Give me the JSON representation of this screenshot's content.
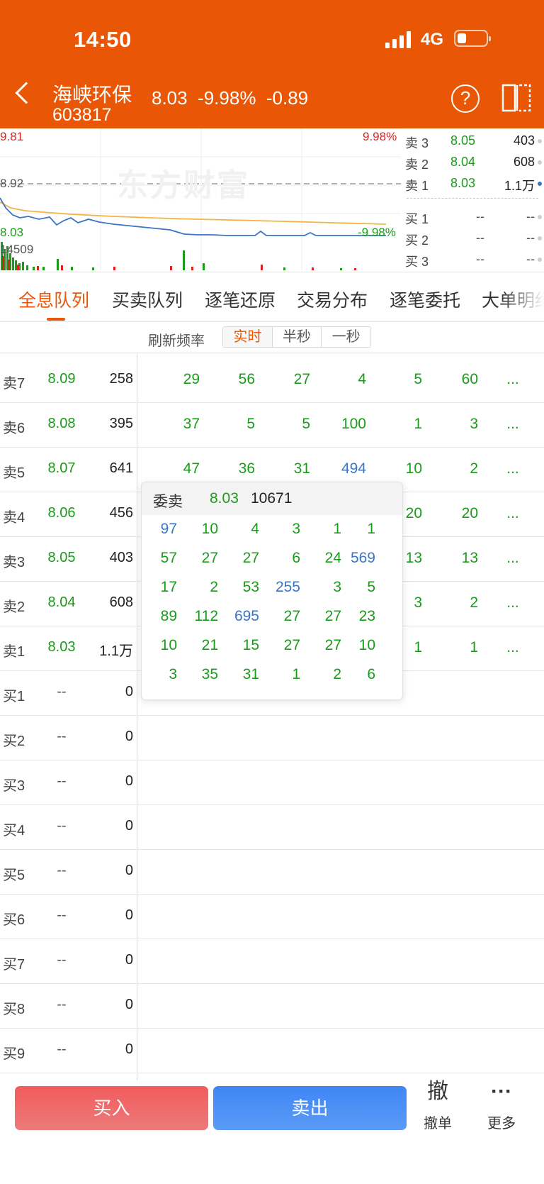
{
  "status": {
    "time": "14:50",
    "network": "4G"
  },
  "header": {
    "name": "海峡环保",
    "code": "603817",
    "quote": "8.03  -9.98%  -0.89",
    "help": "?"
  },
  "chart": {
    "watermark": "东方财富",
    "high": "9.81",
    "high_pct": "9.98%",
    "prev_close": "8.92",
    "low": "8.03",
    "low_pct": "-9.98%",
    "volume": "14509"
  },
  "book": [
    {
      "label": "卖 3",
      "price": "8.05",
      "vol": "403"
    },
    {
      "label": "卖 2",
      "price": "8.04",
      "vol": "608"
    },
    {
      "label": "卖 1",
      "price": "8.03",
      "vol": "1.1万"
    },
    {
      "label": "买 1",
      "price": "--",
      "vol": "--"
    },
    {
      "label": "买 2",
      "price": "--",
      "vol": "--"
    },
    {
      "label": "买 3",
      "price": "--",
      "vol": "--"
    }
  ],
  "tabs": [
    "全息队列",
    "买卖队列",
    "逐笔还原",
    "交易分布",
    "逐笔委托",
    "大单明细"
  ],
  "refresh": {
    "label": "刷新频率",
    "options": [
      "实时",
      "半秒",
      "一秒"
    ]
  },
  "rows": [
    {
      "label": "卖7",
      "price": "8.09",
      "vol": "258",
      "q": [
        "29",
        "56",
        "27",
        "4",
        "5",
        "60",
        "..."
      ]
    },
    {
      "label": "卖6",
      "price": "8.08",
      "vol": "395",
      "q": [
        "37",
        "5",
        "5",
        "100",
        "1",
        "3",
        "..."
      ]
    },
    {
      "label": "卖5",
      "price": "8.07",
      "vol": "641",
      "q": [
        "47",
        "36",
        "31",
        "494",
        "10",
        "2",
        "..."
      ]
    },
    {
      "label": "卖4",
      "price": "8.06",
      "vol": "456",
      "q": [
        "",
        "",
        "",
        "",
        "20",
        "20",
        "..."
      ]
    },
    {
      "label": "卖3",
      "price": "8.05",
      "vol": "403",
      "q": [
        "",
        "",
        "",
        "",
        "13",
        "13",
        "..."
      ]
    },
    {
      "label": "卖2",
      "price": "8.04",
      "vol": "608",
      "q": [
        "",
        "",
        "",
        "",
        "3",
        "2",
        "..."
      ]
    },
    {
      "label": "卖1",
      "price": "8.03",
      "vol": "1.1万",
      "q": [
        "",
        "",
        "",
        "",
        "1",
        "1",
        "..."
      ]
    },
    {
      "label": "买1",
      "price": "--",
      "vol": "0",
      "q": []
    },
    {
      "label": "买2",
      "price": "--",
      "vol": "0",
      "q": []
    },
    {
      "label": "买3",
      "price": "--",
      "vol": "0",
      "q": []
    },
    {
      "label": "买4",
      "price": "--",
      "vol": "0",
      "q": []
    },
    {
      "label": "买5",
      "price": "--",
      "vol": "0",
      "q": []
    },
    {
      "label": "买6",
      "price": "--",
      "vol": "0",
      "q": []
    },
    {
      "label": "买7",
      "price": "--",
      "vol": "0",
      "q": []
    },
    {
      "label": "买8",
      "price": "--",
      "vol": "0",
      "q": []
    },
    {
      "label": "买9",
      "price": "--",
      "vol": "0",
      "q": []
    }
  ],
  "popup": {
    "label": "委卖",
    "price": "8.03",
    "total": "10671",
    "rows": [
      [
        "97",
        "10",
        "4",
        "3",
        "1",
        "1"
      ],
      [
        "57",
        "27",
        "27",
        "6",
        "24",
        "569"
      ],
      [
        "17",
        "2",
        "53",
        "255",
        "3",
        "5"
      ],
      [
        "89",
        "112",
        "695",
        "27",
        "27",
        "23"
      ],
      [
        "10",
        "21",
        "15",
        "27",
        "27",
        "10"
      ],
      [
        "3",
        "35",
        "31",
        "1",
        "2",
        "6"
      ]
    ]
  },
  "actions": {
    "buy": "买入",
    "sell": "卖出",
    "cancel_big": "撤",
    "cancel": "撤单",
    "more_icon": "···",
    "more": "更多"
  },
  "colors": {
    "accent": "#e95706",
    "up": "#e02020",
    "down": "#1a9b1a",
    "big_order": "#3a76c5"
  }
}
